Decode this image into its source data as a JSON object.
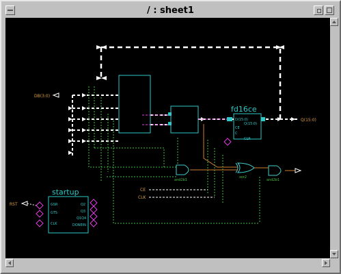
{
  "window": {
    "title": "/ : sheet1"
  },
  "schematic": {
    "register_name": "fd16ce",
    "register_ports": [
      "D(15:0)",
      "Q(15:0)",
      "CE",
      "C",
      "CLR"
    ],
    "startup_name": "startup",
    "startup_left_ports": [
      "GSR",
      "GTS",
      "CLK"
    ],
    "startup_right_ports": [
      "Q2",
      "Q3",
      "Q1Q4",
      "DONEIN"
    ],
    "gate_labels": [
      "and2b1",
      "xor2",
      "and2b1"
    ],
    "net_labels": [
      "DB(3:0)",
      "Q(15:0)",
      "CE",
      "CLK",
      "RST"
    ],
    "colors": {
      "background": "#000000",
      "wire": "#ffffff",
      "component": "#2ec8c8",
      "net_label": "#e0a040",
      "bus": "#e040e0",
      "gate": "#40d0d0",
      "orange_wire": "#d08030"
    }
  },
  "icons": [
    "window-menu-icon",
    "minimize-icon",
    "maximize-icon",
    "scroll-up-icon",
    "scroll-down-icon",
    "scroll-left-icon",
    "scroll-right-icon"
  ]
}
